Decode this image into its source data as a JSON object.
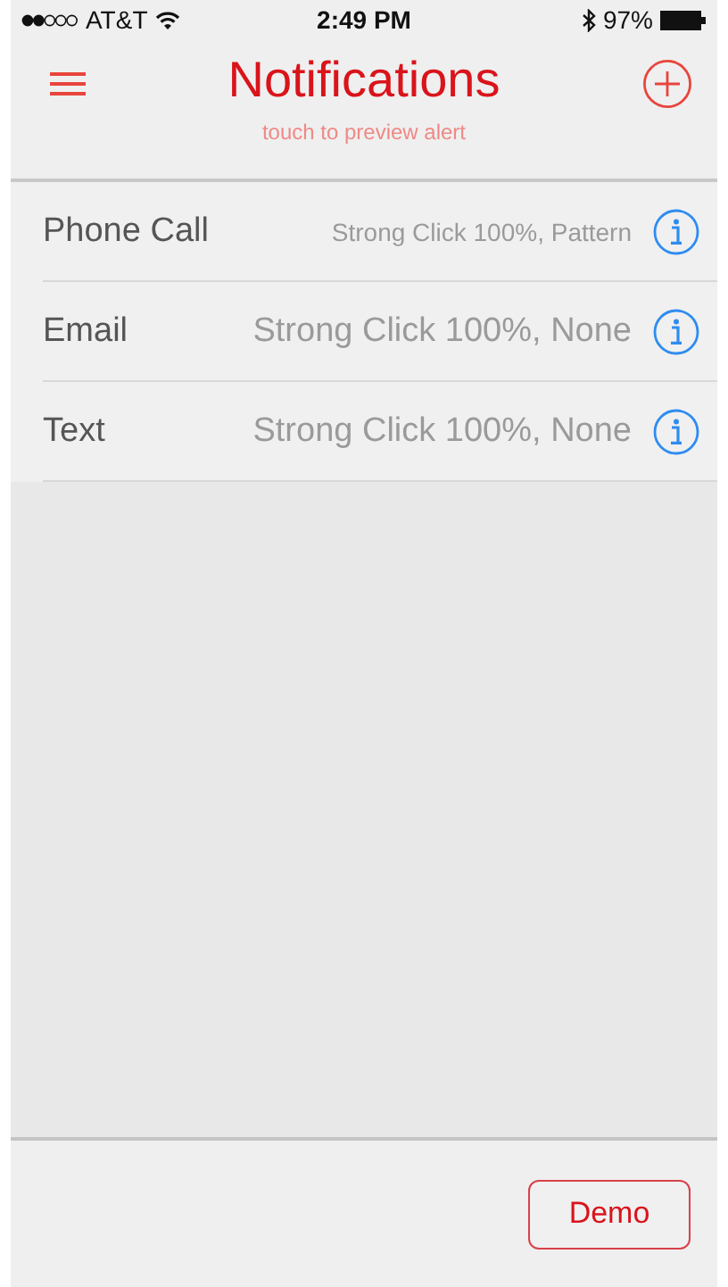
{
  "status_bar": {
    "carrier": "AT&T",
    "time": "2:49 PM",
    "battery": "97%"
  },
  "nav": {
    "title": "Notifications",
    "subtitle": "touch to preview alert"
  },
  "rows": [
    {
      "name": "Phone Call",
      "detail": "Strong Click 100%, Pattern",
      "kind": "small"
    },
    {
      "name": "Email",
      "detail": "Strong Click 100%, None",
      "kind": "normal"
    },
    {
      "name": "Text",
      "detail": "Strong Click 100%, None",
      "kind": "normal"
    }
  ],
  "footer": {
    "button": "Demo"
  }
}
